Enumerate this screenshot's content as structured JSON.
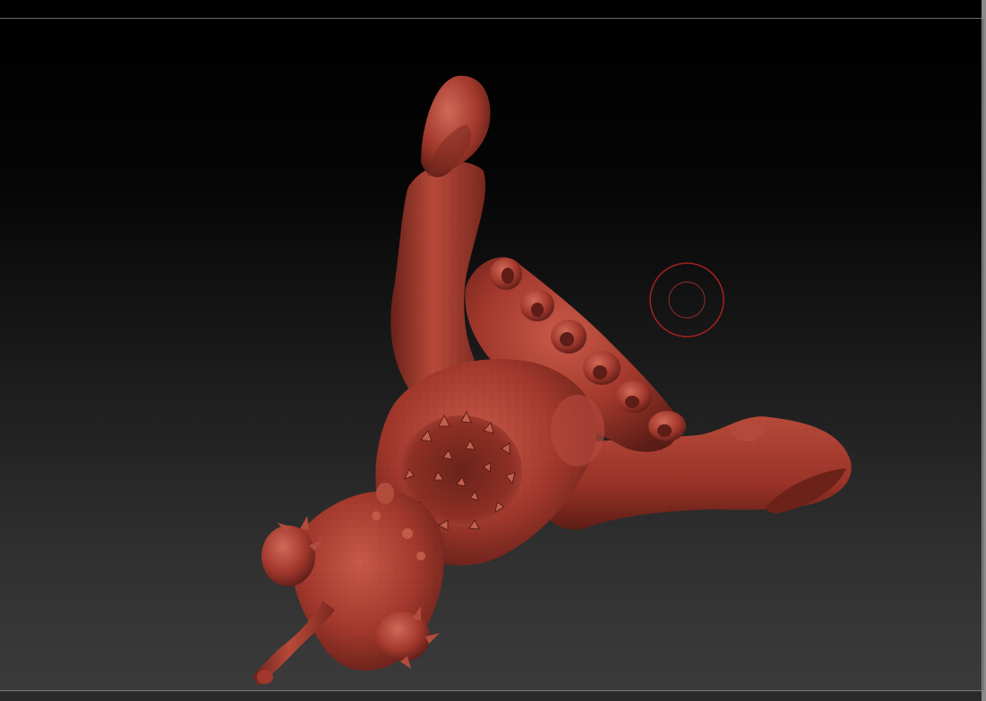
{
  "app": {
    "name": "",
    "canvas_label": ""
  },
  "viewport": {
    "background_top": "#000000",
    "background_bottom": "#3b3b3b",
    "model_color": "#a2382c",
    "model_highlight": "#c85a48",
    "model_shadow": "#5a1c16"
  },
  "brush_cursor": {
    "color": "#a02020",
    "icon": "brush-circle-icon"
  },
  "model": {
    "icon": "sculpt-mesh"
  }
}
